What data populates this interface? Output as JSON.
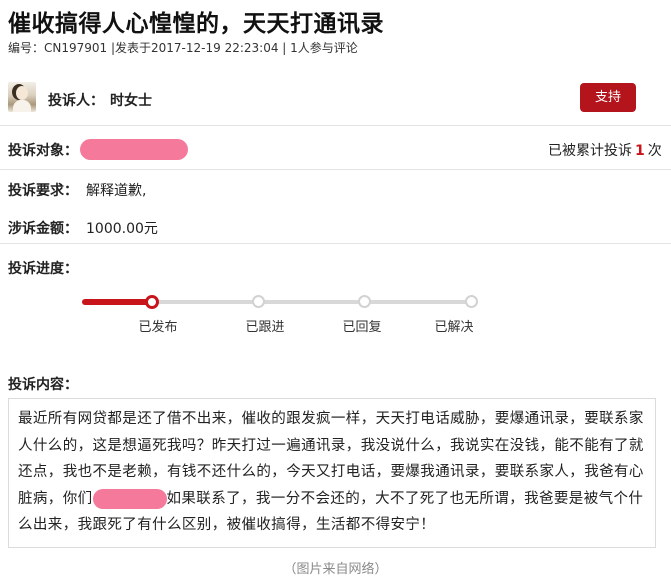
{
  "title": "催收搞得人心惶惶的，天天打通讯录",
  "meta": {
    "text": "编号：CN197901   |发表于2017-12-19 22:23:04 | 1人参与评论"
  },
  "complainant": {
    "label": "投诉人：",
    "name": "时女士",
    "support_label": "支持"
  },
  "target": {
    "label": "投诉对象：",
    "value_visible": "",
    "count_prefix": "已被累计投诉",
    "count": "1",
    "count_suffix": "次"
  },
  "demand": {
    "label": "投诉要求：",
    "value": "解释道歉,"
  },
  "amount": {
    "label": "涉诉金额：",
    "value": "1000.00元"
  },
  "progress": {
    "label": "投诉进度：",
    "steps": [
      "已发布",
      "已跟进",
      "已回复",
      "已解决"
    ],
    "completed_steps": 1,
    "accent_color": "#c8141b"
  },
  "content": {
    "label": "投诉内容：",
    "line1": "最近所有网贷都是还了借不出来，催收的跟发疯一样，天天打电话威胁，要爆通讯录，要联系家",
    "line2": "人什么的，这是想逼死我吗？昨天打过一遍通讯录，我没说什么，我说实在没钱，能不能有了就",
    "line3": "还点，我也不是老赖，有钱不还什么的，今天又打电话，要爆我通讯录，要联系家人，我爸有心",
    "line4_before": "脏病，你们",
    "line4_after": "如果联系了，我一分不会还的，大不了死了也无所谓，我爸要是被气个什",
    "line5": "么出来，我跟死了有什么区别，被催收搞得，生活都不得安宁！"
  },
  "caption": "（图片来自网络）",
  "colors": {
    "brand_red": "#b4141b",
    "redaction_pink": "#f4799a"
  }
}
